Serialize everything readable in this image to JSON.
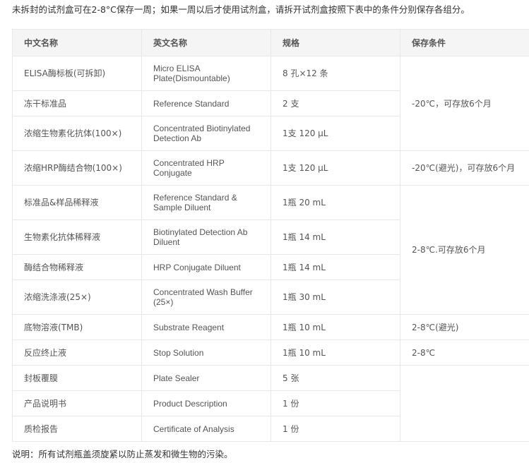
{
  "intro": "未拆封的试剂盒可在2-8°C保存一周；如果一周以后才使用试剂盒，请拆开试剂盒按照下表中的条件分别保存各组分。",
  "note": "说明：所有试剂瓶盖须旋紧以防止蒸发和微生物的污染。",
  "table": {
    "headers": [
      "中文名称",
      "英文名称",
      "规格",
      "保存条件"
    ],
    "rows": [
      {
        "cn": "ELISA酶标板(可拆卸)",
        "en": "Micro ELISA Plate(Dismountable)",
        "spec": "8 孔×12 条",
        "storage": "-20℃，可存放6个月",
        "storage_rowspan": 3
      },
      {
        "cn": "冻干标准品",
        "en": "Reference Standard",
        "spec": "2 支"
      },
      {
        "cn": "浓缩生物素化抗体(100×)",
        "en": "Concentrated Biotinylated Detection Ab",
        "spec": "1支 120 μL"
      },
      {
        "cn": "浓缩HRP酶结合物(100×)",
        "en": "Concentrated HRP Conjugate",
        "spec": "1支 120 μL",
        "storage": "-20℃(避光)，可存放6个月",
        "storage_rowspan": 1
      },
      {
        "cn": "标准品&样品稀释液",
        "en": "Reference Standard & Sample Diluent",
        "spec": "1瓶 20 mL",
        "storage": "2-8℃.可存放6个月",
        "storage_rowspan": 4
      },
      {
        "cn": "生物素化抗体稀释液",
        "en": "Biotinylated Detection Ab Diluent",
        "spec": "1瓶 14 mL"
      },
      {
        "cn": "酶结合物稀释液",
        "en": "HRP Conjugate Diluent",
        "spec": "1瓶 14 mL"
      },
      {
        "cn": "浓缩洗涤液(25×)",
        "en": "Concentrated Wash Buffer (25×)",
        "spec": "1瓶 30 mL"
      },
      {
        "cn": "底物溶液(TMB)",
        "en": "Substrate Reagent",
        "spec": "1瓶 10 mL",
        "storage": "2-8℃(避光)",
        "storage_rowspan": 1
      },
      {
        "cn": "反应终止液",
        "en": "Stop Solution",
        "spec": "1瓶 10 mL",
        "storage": "2-8℃",
        "storage_rowspan": 1
      },
      {
        "cn": "封板覆膜",
        "en": "Plate Sealer",
        "spec": "5 张",
        "storage": "",
        "storage_rowspan": 3
      },
      {
        "cn": "产品说明书",
        "en": "Product Description",
        "spec": "1 份"
      },
      {
        "cn": "质检报告",
        "en": "Certificate of Analysis",
        "spec": "1 份"
      }
    ]
  }
}
